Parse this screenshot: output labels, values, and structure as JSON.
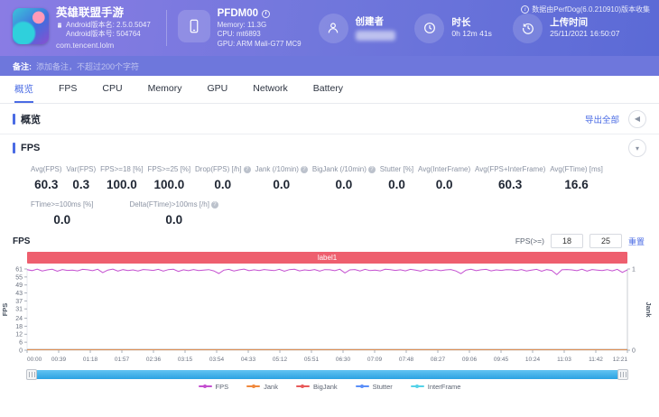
{
  "header": {
    "app": {
      "name": "英雄联盟手游",
      "version_name": "Android版本名: 2.5.0.5047",
      "version_code": "Android版本号: 504764",
      "package": "com.tencent.lolm"
    },
    "device": {
      "name": "PFDM00",
      "memory": "Memory: 11.3G",
      "cpu": "CPU: mt6893",
      "gpu": "GPU: ARM Mali-G77 MC9"
    },
    "creator_label": "创建者",
    "duration_label": "时长",
    "duration_value": "0h 12m 41s",
    "upload_label": "上传时间",
    "upload_value": "25/11/2021 16:50:07",
    "collector_note": "数据由PerfDog(6.0.210910)版本收集"
  },
  "note_bar": {
    "label": "备注:",
    "placeholder": "添加备注，不超过200个字符"
  },
  "tabs": [
    {
      "label": "概览",
      "active": true
    },
    {
      "label": "FPS",
      "active": false
    },
    {
      "label": "CPU",
      "active": false
    },
    {
      "label": "Memory",
      "active": false
    },
    {
      "label": "GPU",
      "active": false
    },
    {
      "label": "Network",
      "active": false
    },
    {
      "label": "Battery",
      "active": false
    }
  ],
  "overview": {
    "title": "概览",
    "export_label": "导出全部"
  },
  "fps_section": {
    "title": "FPS",
    "stats_row1": [
      {
        "label": "Avg(FPS)",
        "value": "60.3",
        "help": false
      },
      {
        "label": "Var(FPS)",
        "value": "0.3",
        "help": false
      },
      {
        "label": "FPS>=18 [%]",
        "value": "100.0",
        "help": false
      },
      {
        "label": "FPS>=25 [%]",
        "value": "100.0",
        "help": false
      },
      {
        "label": "Drop(FPS) [/h]",
        "value": "0.0",
        "help": true
      },
      {
        "label": "Jank (/10min)",
        "value": "0.0",
        "help": true
      },
      {
        "label": "BigJank (/10min)",
        "value": "0.0",
        "help": true
      },
      {
        "label": "Stutter [%]",
        "value": "0.0",
        "help": false
      },
      {
        "label": "Avg(InterFrame)",
        "value": "0.0",
        "help": false
      },
      {
        "label": "Avg(FPS+InterFrame)",
        "value": "60.3",
        "help": false
      },
      {
        "label": "Avg(FTime) [ms]",
        "value": "16.6",
        "help": false
      }
    ],
    "stats_row2": [
      {
        "label": "FTime>=100ms [%]",
        "value": "0.0",
        "help": false
      },
      {
        "label": "Delta(FTime)>100ms [/h]",
        "value": "0.0",
        "help": true
      }
    ]
  },
  "chart_controls": {
    "title": "FPS",
    "threshold_label": "FPS(>=)",
    "threshold_low": "18",
    "threshold_high": "25",
    "reset_label": "重置"
  },
  "chart_data": {
    "type": "line",
    "band_label": "label1",
    "band_color": "#ee5f6e",
    "ylabel_left": "FPS",
    "ylabel_right": "Jank",
    "ylim_left": [
      0,
      61
    ],
    "ylim_right": [
      0,
      1
    ],
    "y_ticks_left": [
      0,
      6,
      12,
      18,
      24,
      31,
      37,
      43,
      49,
      55,
      61
    ],
    "y_ticks_right": [
      0,
      1
    ],
    "x_ticks": [
      "00:00",
      "00:39",
      "01:18",
      "01:57",
      "02:36",
      "03:15",
      "03:54",
      "04:33",
      "05:12",
      "05:51",
      "06:30",
      "07:09",
      "07:48",
      "08:27",
      "09:06",
      "09:45",
      "10:24",
      "11:03",
      "11:42",
      "12:21"
    ],
    "series": [
      {
        "name": "BigJank",
        "color": "#e85a5a",
        "axis": "right",
        "constant": 0
      },
      {
        "name": "Stutter",
        "color": "#5b8ff9",
        "axis": "right",
        "constant": 0
      },
      {
        "name": "InterFrame",
        "color": "#55d2e8",
        "axis": "right",
        "constant": 0
      },
      {
        "name": "Jank",
        "color": "#f0883c",
        "axis": "right",
        "constant": 0
      },
      {
        "name": "FPS",
        "color": "#c44fd0",
        "axis": "left",
        "values": [
          60.5,
          59.8,
          60.9,
          59.5,
          60.3,
          60.8,
          59.3,
          60.6,
          59.9,
          60.2,
          59.6,
          60.7,
          60.4,
          59.7,
          60.8,
          58.2,
          60.2,
          60.9,
          59.4,
          60.5,
          59.8,
          60.3,
          59.5,
          60.6,
          60.3,
          59.9,
          60.7,
          59.4,
          60.5,
          60.8,
          59.2,
          60.4,
          59.7,
          60.6,
          59.8,
          60.2,
          60.5,
          59.6,
          57.6,
          60.1,
          60.7,
          59.5,
          60.3,
          60.9,
          59.7,
          60.4,
          59.8,
          60.6,
          60.2,
          59.8,
          60.7,
          59.3,
          60.5,
          60.8,
          59.6,
          60.3,
          59.9,
          60.6,
          59.4,
          60.5,
          60.4,
          59.7,
          60.8,
          58.0,
          60.3,
          60.6,
          59.5,
          60.7,
          59.8,
          60.2,
          59.6,
          60.8,
          60.5,
          59.9,
          60.4,
          59.6,
          60.7,
          60.2,
          59.4,
          60.6,
          59.8,
          60.5,
          59.7,
          60.3,
          60.6,
          59.5,
          57.5,
          60.2,
          60.8,
          59.7,
          60.4,
          60.7,
          59.6,
          60.3,
          59.9,
          60.5,
          60.4,
          59.8,
          60.6,
          59.5,
          60.2,
          60.7,
          59.3,
          60.5,
          59.9,
          56.8,
          60.4,
          60.6,
          60.3,
          59.7,
          60.8,
          59.4,
          60.6,
          60.2,
          59.8,
          60.5,
          59.6,
          60.7,
          58.4,
          60.4
        ]
      }
    ],
    "legend_order": [
      "FPS",
      "Jank",
      "BigJank",
      "Stutter",
      "InterFrame"
    ]
  }
}
